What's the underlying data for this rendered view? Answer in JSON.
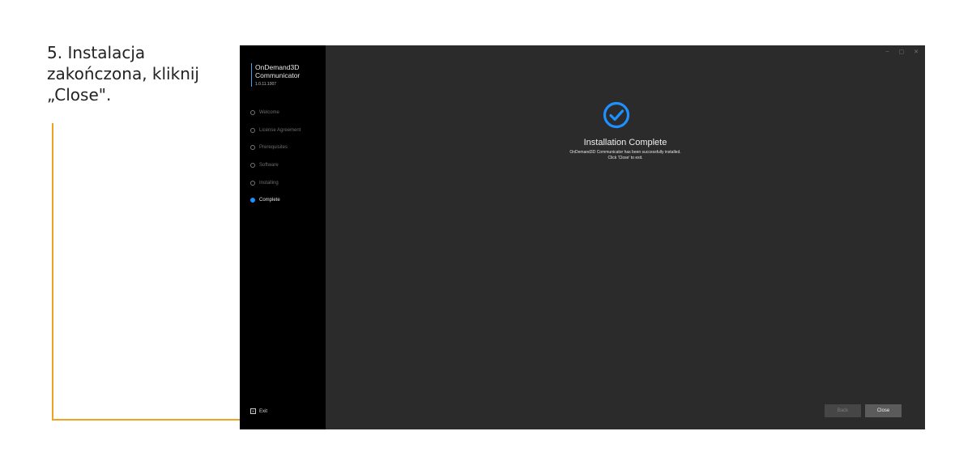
{
  "instruction": {
    "text": "5. Instalacja\nzakończona, kliknij\n„Close\"."
  },
  "colors": {
    "accent": "#f0a323",
    "installer_blue": "#1e90ff",
    "sidebar_bg": "#000000",
    "content_bg": "#2b2b2b"
  },
  "installer": {
    "brand": {
      "name": "OnDemand3D\nCommunicator",
      "version": "1.0.11.1007"
    },
    "steps": [
      {
        "label": "Welcome",
        "active": false
      },
      {
        "label": "License Agreement",
        "active": false
      },
      {
        "label": "Prerequisites",
        "active": false
      },
      {
        "label": "Software",
        "active": false
      },
      {
        "label": "Installing",
        "active": false
      },
      {
        "label": "Complete",
        "active": true
      }
    ],
    "exit_label": "Exit",
    "window_controls": {
      "minimize": "–",
      "maximize": "▢",
      "close": "✕"
    },
    "complete_title": "Installation Complete",
    "message_line1": "OnDemand3D Communicator has been successfully installed.",
    "message_line2": "Click 'Close' to exit.",
    "buttons": {
      "back": "Back",
      "close": "Close"
    },
    "icons": {
      "status": "check-circle-icon",
      "exit": "exit-icon"
    }
  }
}
